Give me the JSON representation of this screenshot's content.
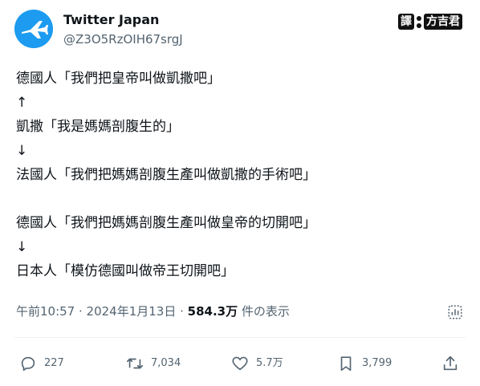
{
  "author": {
    "display_name": "Twitter Japan",
    "handle": "@Z3O5RzOIH67srgJ"
  },
  "translator_badge": {
    "label_left": "譯",
    "label_right": "方吉君"
  },
  "tweet": {
    "lines": [
      "德國人「我們把皇帝叫做凱撒吧」",
      "↑",
      "凱撒「我是媽媽剖腹生的」",
      "↓",
      "法國人「我們把媽媽剖腹生產叫做凱撒的手術吧」",
      "",
      "德國人「我們把媽媽剖腹生產叫做皇帝的切開吧」",
      "↓",
      "日本人「模仿德國叫做帝王切開吧」"
    ]
  },
  "meta": {
    "timestamp": "午前10:57 · 2024年1月13日 · ",
    "views_count": "584.3万",
    "views_label": " 件の表示"
  },
  "actions": {
    "reply_count": "227",
    "retweet_count": "7,034",
    "like_count": "5.7万",
    "bookmark_count": "3,799"
  },
  "icons": {
    "avatar": "airplane-icon",
    "reply": "reply-icon",
    "retweet": "retweet-icon",
    "like": "heart-icon",
    "bookmark": "bookmark-icon",
    "share": "share-icon",
    "analytics": "analytics-icon"
  },
  "colors": {
    "avatar_bg": "#1d9bf0",
    "secondary_text": "#536471",
    "primary_text": "#0f1419"
  }
}
